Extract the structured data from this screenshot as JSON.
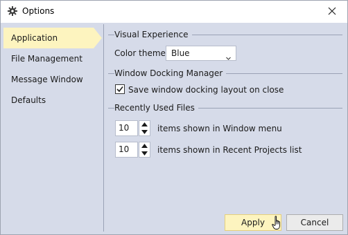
{
  "window": {
    "title": "Options",
    "title_icon": "gear-icon",
    "close_icon": "close-icon"
  },
  "sidebar": {
    "items": [
      {
        "label": "Application",
        "active": true
      },
      {
        "label": "File Management",
        "active": false
      },
      {
        "label": "Message Window",
        "active": false
      },
      {
        "label": "Defaults",
        "active": false
      }
    ]
  },
  "visual_experience": {
    "heading": "Visual Experience",
    "color_theme_label": "Color theme:",
    "color_theme_value": "Blue"
  },
  "docking": {
    "heading": "Window Docking Manager",
    "save_layout_label": "Save window docking layout on close",
    "save_layout_checked": true
  },
  "recent_files": {
    "heading": "Recently Used Files",
    "window_menu_count": "10",
    "window_menu_label": "items shown in Window menu",
    "recent_projects_count": "10",
    "recent_projects_label": "items shown in Recent Projects list"
  },
  "buttons": {
    "apply": "Apply",
    "cancel": "Cancel"
  },
  "colors": {
    "panel_bg": "#d6dbe9",
    "selected_bg": "#fdf4bf",
    "separator": "#9aa1b5"
  }
}
